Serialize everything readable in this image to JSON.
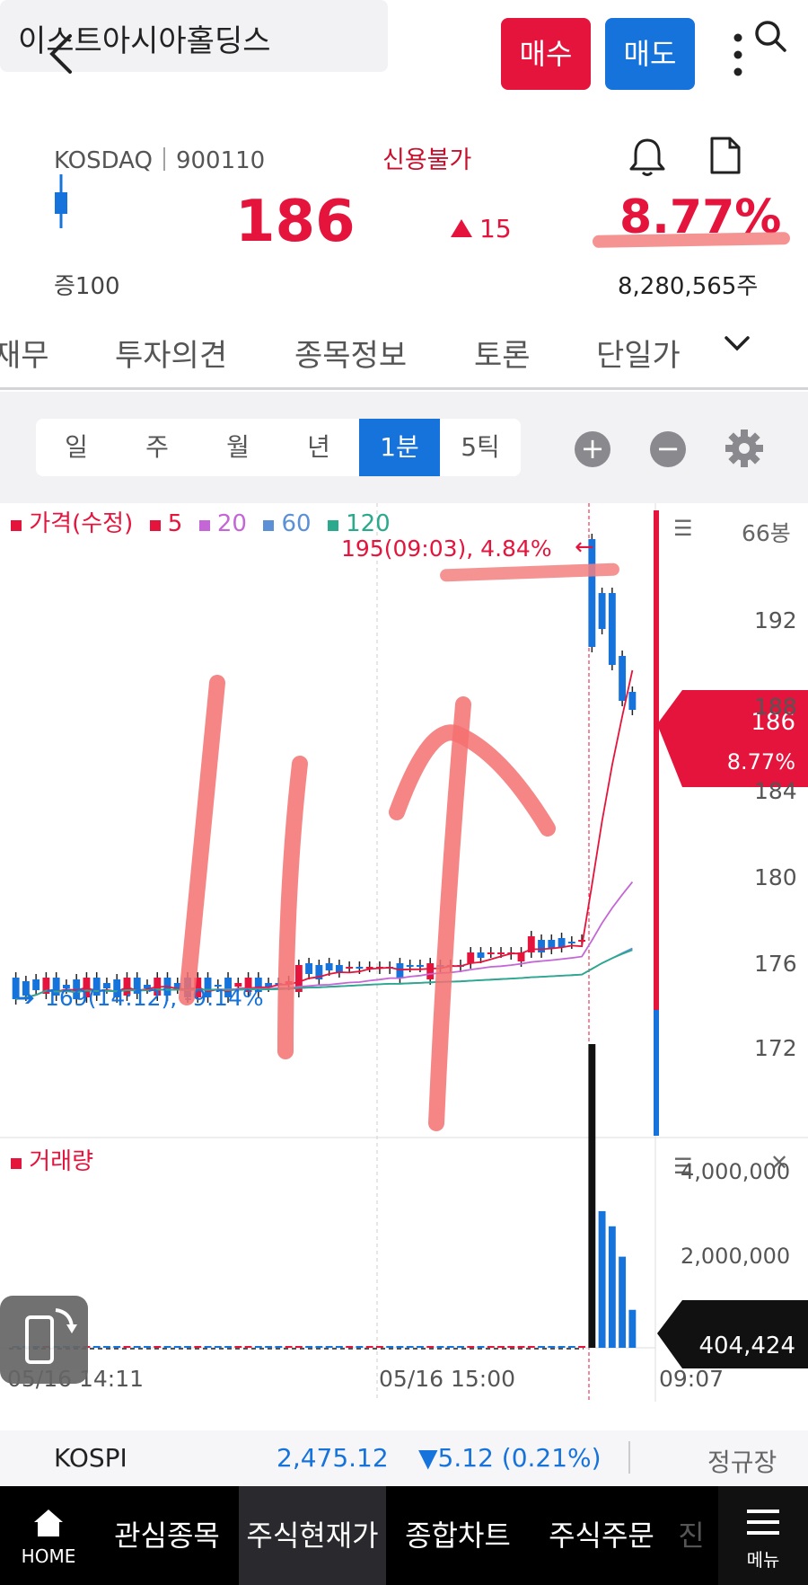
{
  "header": {
    "search_text": "이스트아시아홀딩스",
    "buy_label": "매수",
    "sell_label": "매도"
  },
  "quote": {
    "market_code": "KOSDAQ｜900110",
    "credit_status": "신용불가",
    "price": "186",
    "change": "15",
    "change_pct": "8.77%",
    "volume": "8,280,565주",
    "margin_label": "증100"
  },
  "tabs": [
    "재무",
    "투자의견",
    "종목정보",
    "토론",
    "단일가"
  ],
  "periods": [
    "일",
    "주",
    "월",
    "년",
    "1분",
    "5틱"
  ],
  "selected_period": "1분",
  "chart_data": {
    "type": "candlestick",
    "legend": {
      "price": "가격(수정)",
      "ma": [
        "5",
        "20",
        "60",
        "120"
      ],
      "ma_colors": [
        "#e5143c",
        "#c466d6",
        "#5b8fd6",
        "#2aa98c"
      ]
    },
    "count_label": "66봉",
    "high_annotation": "195(09:03), 4.84%",
    "low_annotation": "169(14:12), -9.14%",
    "price_ticks": [
      "192",
      "188",
      "184",
      "180",
      "176",
      "172"
    ],
    "price_marker": {
      "value": "186",
      "pct": "8.77%"
    },
    "volume_label": "거래량",
    "volume_ticks": [
      "4,000,000",
      "2,000,000"
    ],
    "volume_marker": "404,424",
    "time_ticks": [
      "05/16 14:11",
      "05/16 15:00",
      "09:07"
    ],
    "ylim": [
      169,
      196
    ],
    "candles": [
      {
        "o": 170.6,
        "c": 169.4
      },
      {
        "o": 170.4,
        "c": 169.6
      },
      {
        "o": 170.5,
        "c": 169.9
      },
      {
        "o": 169.7,
        "c": 170.6
      },
      {
        "o": 170.6,
        "c": 169.6
      },
      {
        "o": 170.2,
        "c": 170.0
      },
      {
        "o": 170.5,
        "c": 169.4
      },
      {
        "o": 169.5,
        "c": 170.6
      },
      {
        "o": 170.6,
        "c": 169.6
      },
      {
        "o": 170.3,
        "c": 170.0
      },
      {
        "o": 170.5,
        "c": 169.5
      },
      {
        "o": 169.6,
        "c": 170.6
      },
      {
        "o": 170.6,
        "c": 169.7
      },
      {
        "o": 170.2,
        "c": 170.0
      },
      {
        "o": 169.6,
        "c": 170.6
      },
      {
        "o": 170.6,
        "c": 169.6
      },
      {
        "o": 170.3,
        "c": 170.0
      },
      {
        "o": 170.6,
        "c": 169.5
      },
      {
        "o": 169.5,
        "c": 170.6
      },
      {
        "o": 170.6,
        "c": 169.5
      },
      {
        "o": 170.2,
        "c": 170.1
      },
      {
        "o": 170.6,
        "c": 169.5
      },
      {
        "o": 170.1,
        "c": 170.3
      },
      {
        "o": 169.8,
        "c": 170.6
      },
      {
        "o": 170.6,
        "c": 169.8
      },
      {
        "o": 170.3,
        "c": 170.1
      },
      {
        "o": 170.3,
        "c": 170.2
      },
      {
        "o": 170.2,
        "c": 170.4
      },
      {
        "o": 169.8,
        "c": 171.3
      },
      {
        "o": 171.4,
        "c": 170.8
      },
      {
        "o": 171.3,
        "c": 170.5
      },
      {
        "o": 171.4,
        "c": 171.0
      },
      {
        "o": 171.3,
        "c": 170.9
      },
      {
        "o": 171.2,
        "c": 171.2
      },
      {
        "o": 171.2,
        "c": 171.1
      },
      {
        "o": 171.2,
        "c": 171.2
      },
      {
        "o": 171.1,
        "c": 171.2
      },
      {
        "o": 171.2,
        "c": 171.1
      },
      {
        "o": 171.4,
        "c": 170.6
      },
      {
        "o": 171.3,
        "c": 171.2
      },
      {
        "o": 171.3,
        "c": 171.2
      },
      {
        "o": 170.5,
        "c": 171.4
      },
      {
        "o": 171.3,
        "c": 171.2
      },
      {
        "o": 171.3,
        "c": 171.2
      },
      {
        "o": 171.3,
        "c": 171.2
      },
      {
        "o": 171.4,
        "c": 172.0
      },
      {
        "o": 172.0,
        "c": 171.7
      },
      {
        "o": 172.0,
        "c": 172.0
      },
      {
        "o": 172.0,
        "c": 172.0
      },
      {
        "o": 171.9,
        "c": 172.0
      },
      {
        "o": 171.5,
        "c": 172.0
      },
      {
        "o": 172.0,
        "c": 172.9
      },
      {
        "o": 172.7,
        "c": 172.0
      },
      {
        "o": 172.7,
        "c": 172.2
      },
      {
        "o": 172.8,
        "c": 172.3
      },
      {
        "o": 172.6,
        "c": 172.5
      },
      {
        "o": 172.6,
        "c": 172.7
      },
      {
        "o": 195.0,
        "c": 189.0
      },
      {
        "o": 192.0,
        "c": 190.0
      },
      {
        "o": 192.0,
        "c": 188.0
      },
      {
        "o": 188.5,
        "c": 186.0
      },
      {
        "o": 186.5,
        "c": 185.5
      }
    ],
    "volumes": [
      5,
      5,
      5,
      5,
      5,
      5,
      5,
      5,
      5,
      5,
      5,
      5,
      5,
      5,
      5,
      5,
      5,
      5,
      5,
      5,
      5,
      5,
      5,
      5,
      5,
      5,
      5,
      5,
      5,
      5,
      5,
      5,
      5,
      5,
      5,
      5,
      5,
      5,
      5,
      5,
      5,
      5,
      5,
      5,
      5,
      5,
      5,
      5,
      5,
      5,
      5,
      5,
      5,
      5,
      5,
      5,
      5,
      4000,
      1800,
      1600,
      1200,
      500
    ]
  },
  "kospi": {
    "name": "KOSPI",
    "value": "2,475.12",
    "change": "▼5.12 (0.21%)",
    "session": "정규장"
  },
  "bottom_nav": {
    "home": "HOME",
    "items": [
      "관심종목",
      "주식현재가",
      "종합차트",
      "주식주문",
      "진"
    ],
    "menu": "메뉴"
  }
}
